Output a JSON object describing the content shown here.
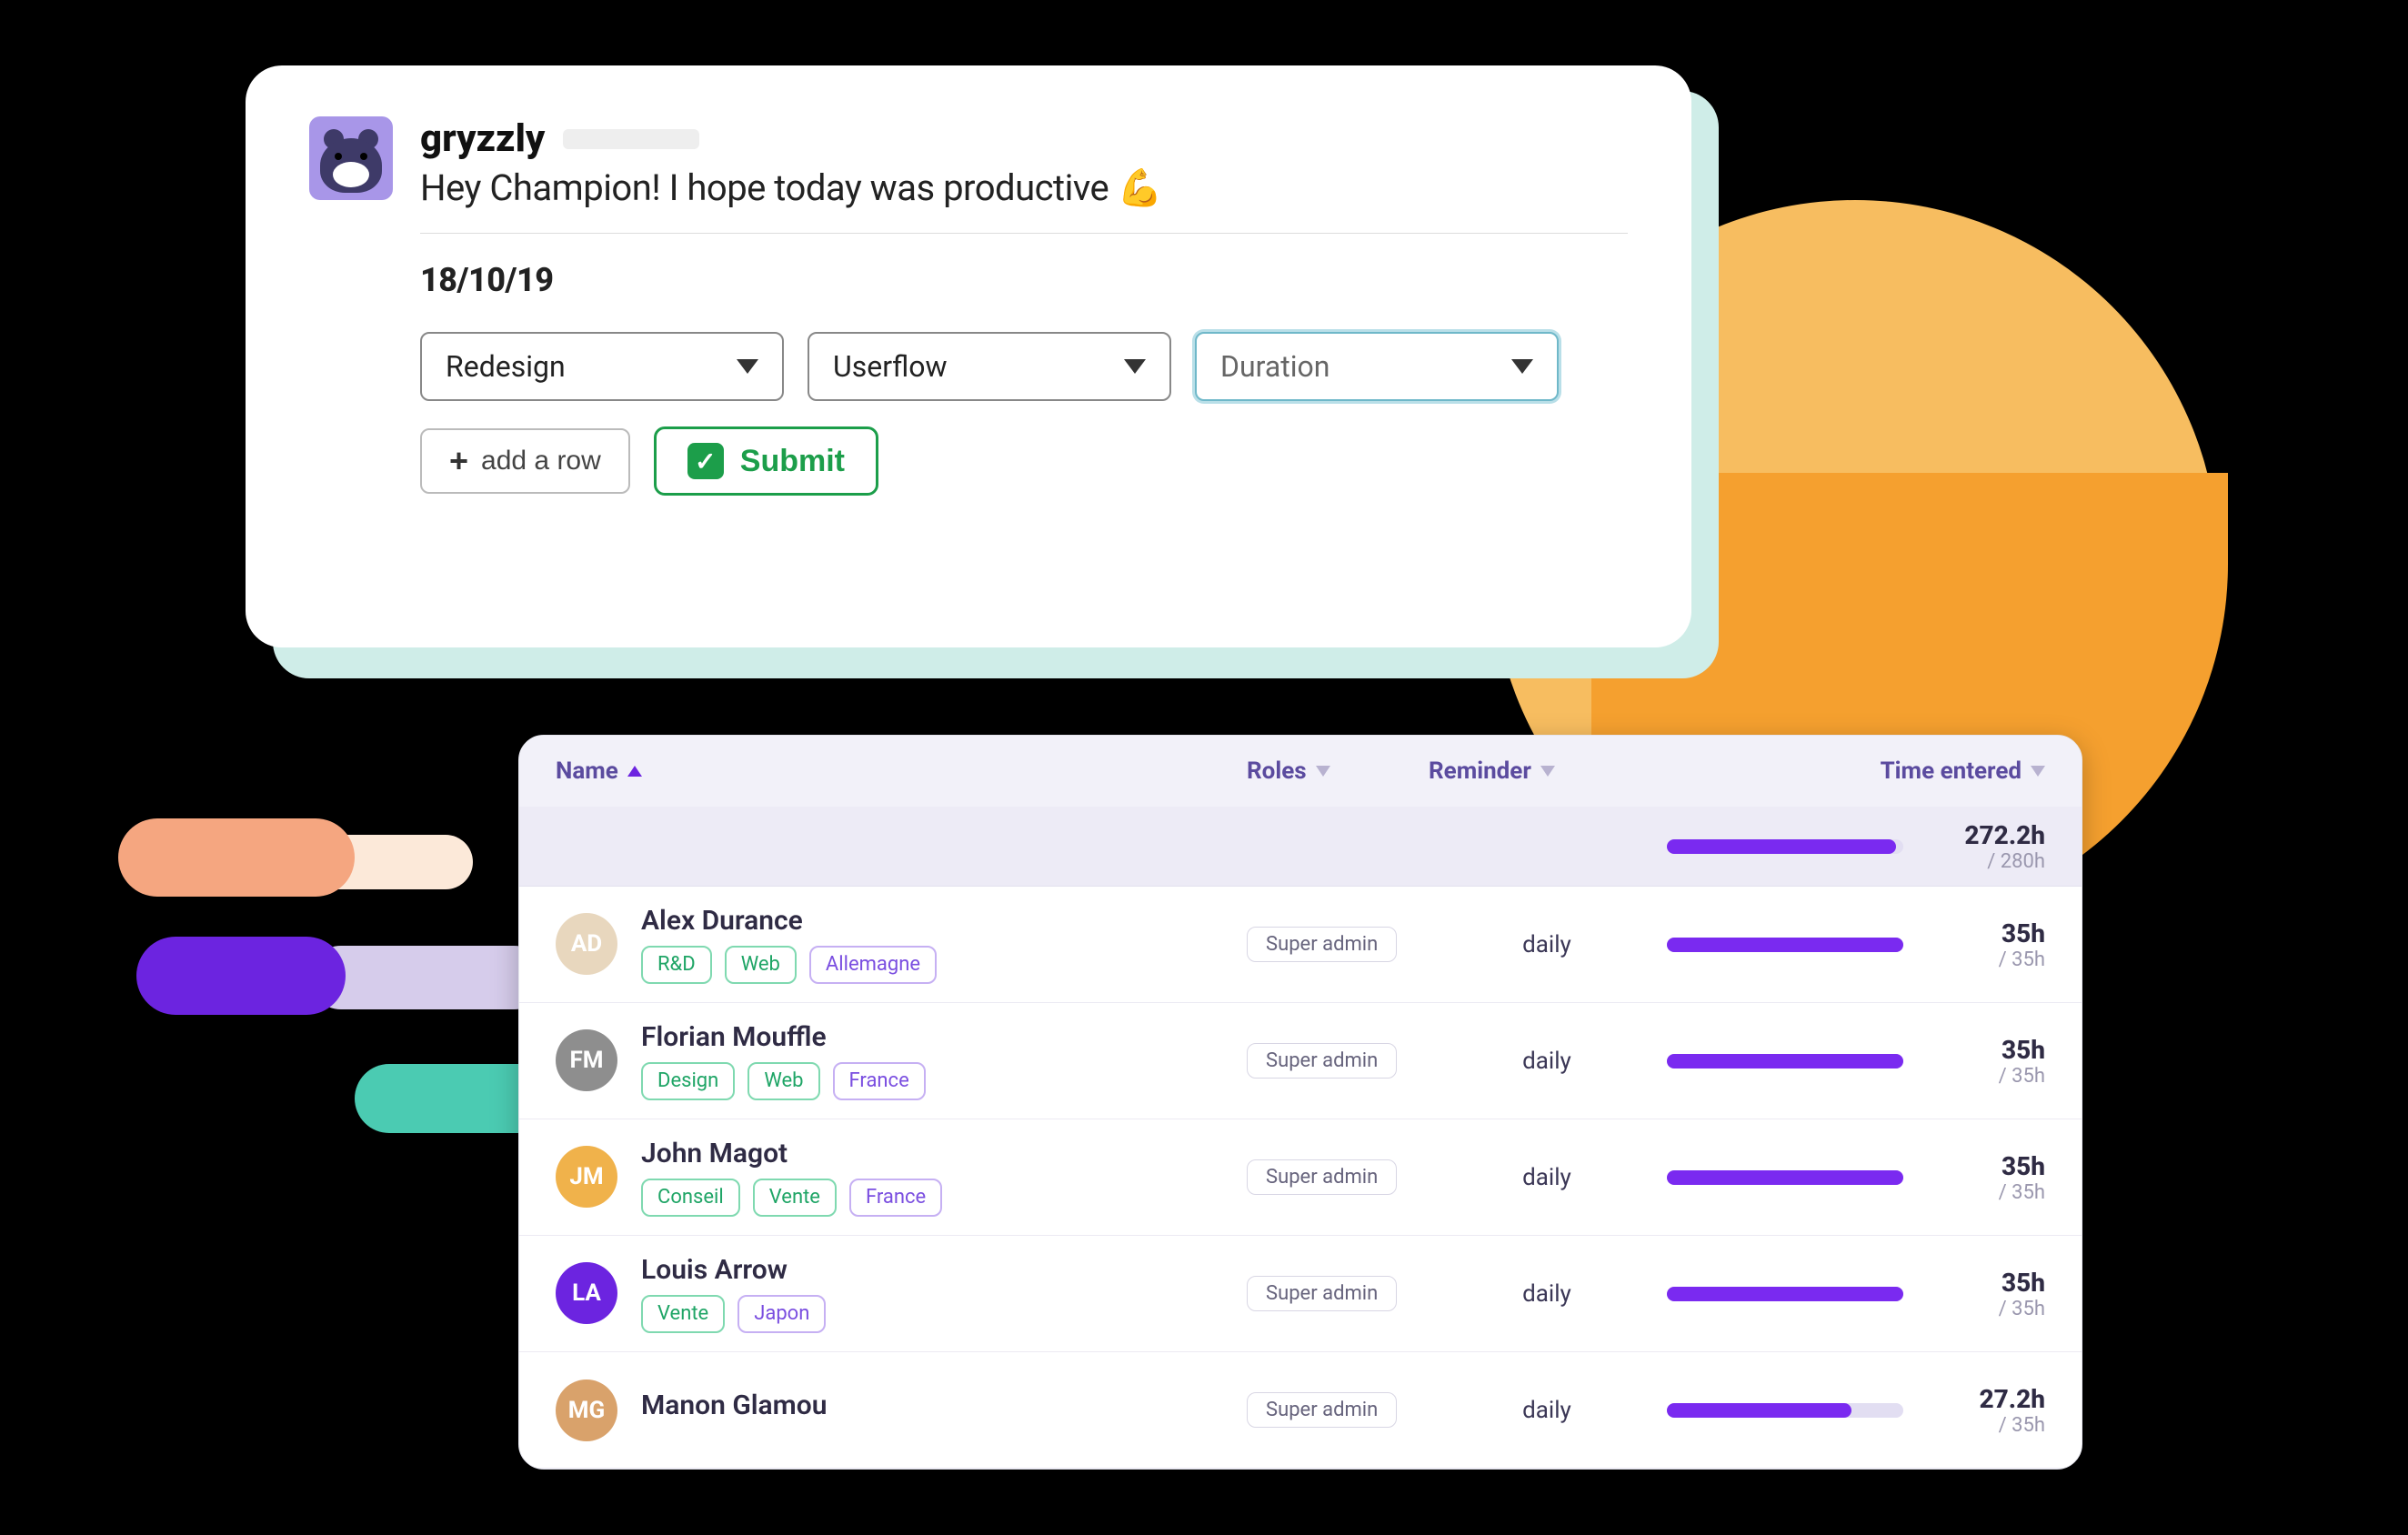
{
  "slack": {
    "app_name": "gryzzly",
    "greeting": "Hey Champion! I hope today was productive 💪",
    "date": "18/10/19",
    "selects": {
      "project": "Redesign",
      "task": "Userflow",
      "duration_placeholder": "Duration"
    },
    "add_row_label": "add a row",
    "submit_label": "Submit"
  },
  "table": {
    "columns": {
      "name": "Name",
      "roles": "Roles",
      "reminder": "Reminder",
      "time": "Time entered"
    },
    "summary": {
      "entered": "272.2h",
      "total": "/ 280h",
      "progress_pct": 97
    },
    "rows": [
      {
        "name": "Alex Durance",
        "avatar_bg": "#E8D7BE",
        "initials": "AD",
        "tags": [
          {
            "label": "R&D",
            "tone": "green"
          },
          {
            "label": "Web",
            "tone": "green"
          },
          {
            "label": "Allemagne",
            "tone": "purple"
          }
        ],
        "role": "Super admin",
        "reminder": "daily",
        "entered": "35h",
        "total": "/ 35h",
        "progress_pct": 100
      },
      {
        "name": "Florian Mouffle",
        "avatar_bg": "#8E8E8E",
        "initials": "FM",
        "tags": [
          {
            "label": "Design",
            "tone": "green"
          },
          {
            "label": "Web",
            "tone": "green"
          },
          {
            "label": "France",
            "tone": "purple"
          }
        ],
        "role": "Super admin",
        "reminder": "daily",
        "entered": "35h",
        "total": "/ 35h",
        "progress_pct": 100
      },
      {
        "name": "John Magot",
        "avatar_bg": "#F0B24B",
        "initials": "JM",
        "tags": [
          {
            "label": "Conseil",
            "tone": "green"
          },
          {
            "label": "Vente",
            "tone": "green"
          },
          {
            "label": "France",
            "tone": "purple"
          }
        ],
        "role": "Super admin",
        "reminder": "daily",
        "entered": "35h",
        "total": "/ 35h",
        "progress_pct": 100
      },
      {
        "name": "Louis Arrow",
        "avatar_bg": "#6C24E0",
        "initials": "LA",
        "tags": [
          {
            "label": "Vente",
            "tone": "green"
          },
          {
            "label": "Japon",
            "tone": "purple"
          }
        ],
        "role": "Super admin",
        "reminder": "daily",
        "entered": "35h",
        "total": "/ 35h",
        "progress_pct": 100
      },
      {
        "name": "Manon Glamou",
        "avatar_bg": "#D9A26B",
        "initials": "MG",
        "tags": [],
        "role": "Super admin",
        "reminder": "daily",
        "entered": "27.2h",
        "total": "/ 35h",
        "progress_pct": 78
      }
    ]
  }
}
